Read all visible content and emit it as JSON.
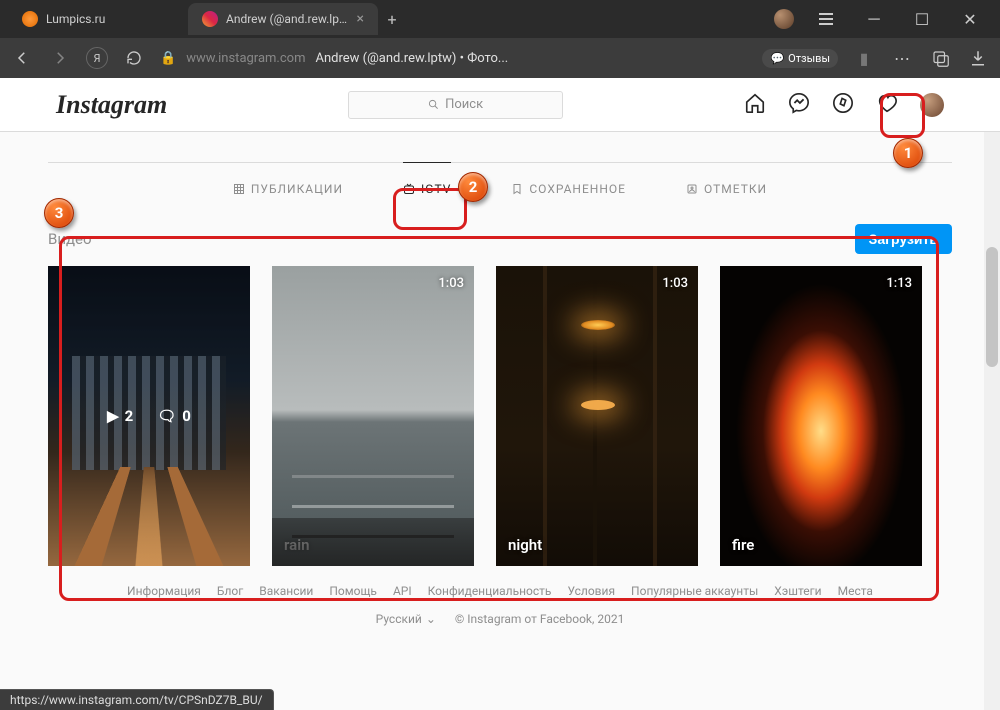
{
  "browser": {
    "tabs": [
      {
        "title": "Lumpics.ru",
        "active": false
      },
      {
        "title": "Andrew (@and.rew.lptw",
        "active": true
      }
    ],
    "address": {
      "domain": "www.instagram.com",
      "title": "Andrew (@and.rew.lptw) • Фото..."
    },
    "reviews": "Отзывы",
    "status_url": "https://www.instagram.com/tv/CPSnDZ7B_BU/"
  },
  "ig": {
    "logo": "Instagram",
    "search_placeholder": "Поиск",
    "tabs": {
      "posts": "ПУБЛИКАЦИИ",
      "igtv": "IGTV",
      "saved": "СОХРАНЕННОЕ",
      "tagged": "ОТМЕТКИ"
    },
    "video_section": {
      "title": "Видео",
      "upload": "Загрузить",
      "videos": [
        {
          "title": "",
          "duration": "",
          "plays": "2",
          "comments": "0"
        },
        {
          "title": "rain",
          "duration": "1:03"
        },
        {
          "title": "night",
          "duration": "1:03"
        },
        {
          "title": "fire",
          "duration": "1:13"
        }
      ]
    },
    "footer": {
      "links": [
        "Информация",
        "Блог",
        "Вакансии",
        "Помощь",
        "API",
        "Конфиденциальность",
        "Условия",
        "Популярные аккаунты",
        "Хэштеги",
        "Места"
      ],
      "lang": "Русский",
      "copy": "© Instagram от Facebook, 2021"
    }
  },
  "annotations": {
    "m1": "1",
    "m2": "2",
    "m3": "3"
  }
}
